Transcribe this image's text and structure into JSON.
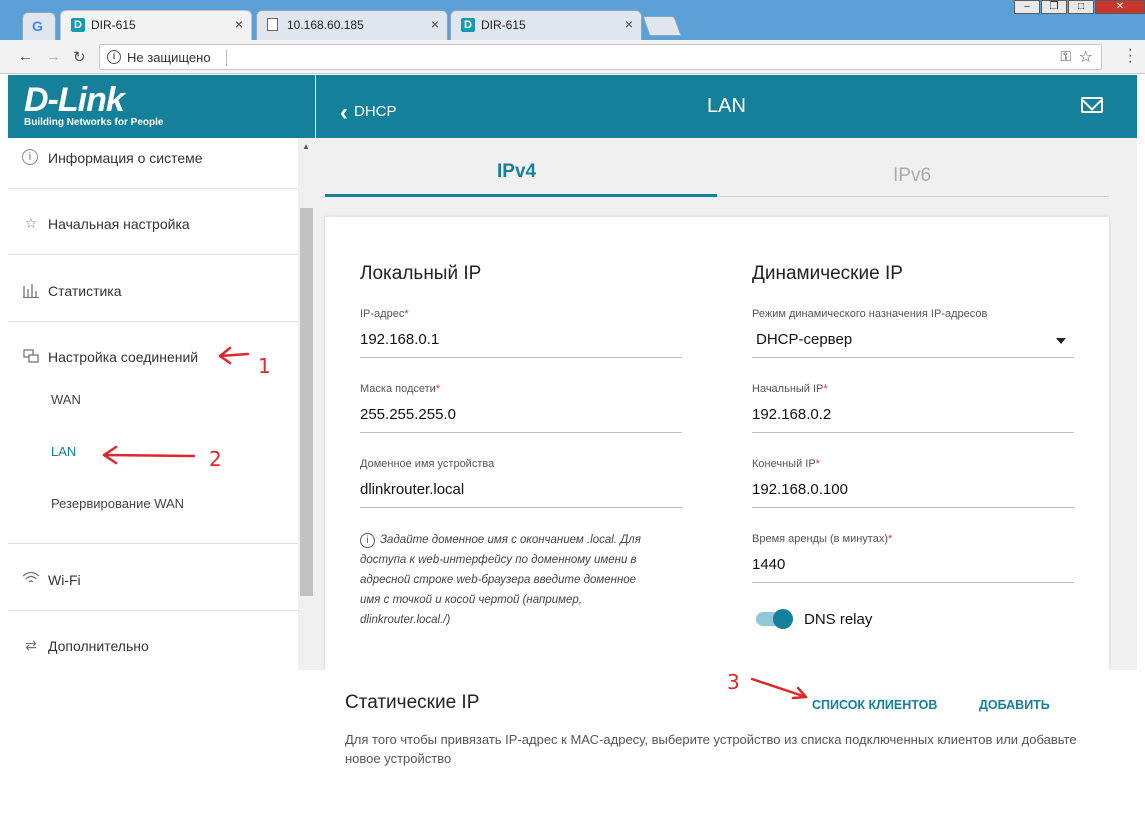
{
  "browser": {
    "tabs": [
      {
        "title": "DIR-615",
        "icon": "dlink-favicon",
        "active": true
      },
      {
        "title": "10.168.60.185",
        "icon": "page-icon",
        "active": false
      },
      {
        "title": "DIR-615",
        "icon": "dlink-favicon",
        "active": false
      }
    ],
    "address": {
      "security_label": "Не защищено",
      "url": ""
    }
  },
  "brand": {
    "logo": "D-Link",
    "tagline": "Building Networks for People"
  },
  "sidebar": {
    "items": [
      {
        "label": "Информация о системе",
        "icon": "info-icon"
      },
      {
        "label": "Начальная настройка",
        "icon": "star-icon"
      },
      {
        "label": "Статистика",
        "icon": "bar-chart-icon"
      },
      {
        "label": "Настройка соединений",
        "icon": "connections-icon"
      },
      {
        "label": "Wi-Fi",
        "icon": "wifi-icon"
      },
      {
        "label": "Дополнительно",
        "icon": "arrows-icon"
      }
    ],
    "subitems": [
      {
        "label": "WAN"
      },
      {
        "label": "LAN",
        "active": true
      },
      {
        "label": "Резервирование WAN"
      }
    ]
  },
  "header": {
    "back_label": "DHCP",
    "title": "LAN"
  },
  "ip_tabs": [
    {
      "label": "IPv4",
      "active": true
    },
    {
      "label": "IPv6",
      "active": false
    }
  ],
  "local_ip": {
    "title": "Локальный IP",
    "ip_label": "IP-адрес",
    "ip_value": "192.168.0.1",
    "mask_label": "Маска подсети",
    "mask_value": "255.255.255.0",
    "domain_label": "Доменное имя устройства",
    "domain_value": "dlinkrouter.local",
    "hint": "Задайте доменное имя с окончанием .local. Для доступа к web-интерфейсу по доменному имени в адресной строке web-браузера введите доменное имя с точкой и косой чертой (например, dlinkrouter.local./)"
  },
  "dynamic_ip": {
    "title": "Динамические IP",
    "mode_label": "Режим динамического назначения IP-адресов",
    "mode_value": "DHCP-сервер",
    "start_label": "Начальный IP",
    "start_value": "192.168.0.2",
    "end_label": "Конечный IP",
    "end_value": "192.168.0.100",
    "lease_label": "Время аренды (в минутах)",
    "lease_value": "1440",
    "dns_relay_label": "DNS relay",
    "dns_relay_on": true
  },
  "static_ip": {
    "title": "Статические IP",
    "clients_button": "СПИСОК КЛИЕНТОВ",
    "add_button": "ДОБАВИТЬ",
    "description": "Для того чтобы привязать IP-адрес к МАС-адресу, выберите устройство из списка подключенных клиентов или добавьте новое устройство"
  },
  "annotations": [
    "1",
    "2",
    "3"
  ],
  "colors": {
    "accent": "#14809a",
    "annotation": "#e0262a",
    "required": "#d33333"
  }
}
